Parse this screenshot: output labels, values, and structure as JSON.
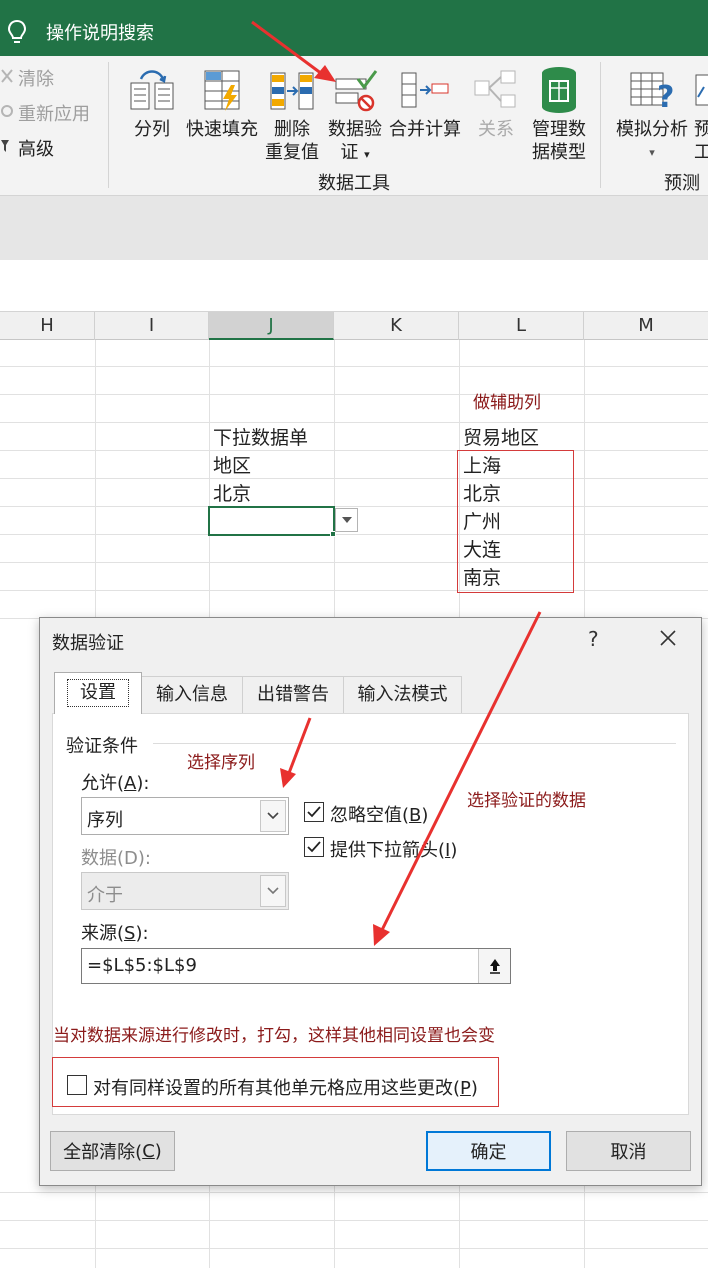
{
  "titlebar": {
    "search_text": "操作说明搜索",
    "bg_color": "#217346"
  },
  "ribbon": {
    "sort_filter": {
      "clear_label": "清除",
      "reapply_label": "重新应用",
      "advanced_label": "高级"
    },
    "data_tools": {
      "group_label": "数据工具",
      "text_to_columns": "分列",
      "flash_fill": "快速填充",
      "remove_duplicates_1": "删除",
      "remove_duplicates_2": "重复值",
      "data_validation_1": "数据验",
      "data_validation_2": "证",
      "consolidate": "合并计算",
      "relationships": "关系",
      "manage_data_model_1": "管理数",
      "manage_data_model_2": "据模型"
    },
    "forecast": {
      "group_label": "预测",
      "what_if_analysis": "模拟分析",
      "forecast_sheet_partial_1": "预",
      "forecast_sheet_partial_2": "工"
    }
  },
  "sheet": {
    "columns": [
      "H",
      "I",
      "J",
      "K",
      "L",
      "M"
    ],
    "selected_column": "J",
    "cells": {
      "j_header": "下拉数据单",
      "j_region": "地区",
      "j_beijing": "北京",
      "l_header": "贸易地区",
      "l_items": [
        "上海",
        "北京",
        "广州",
        "大连",
        "南京"
      ]
    }
  },
  "annotations": {
    "helper_column": "做辅助列",
    "select_sequence": "选择序列",
    "select_validation_data": "选择验证的数据",
    "apply_note": "当对数据来源进行修改时，打勾，这样其他相同设置也会变",
    "annotation_color": "#8b1a1a",
    "arrow_color": "#e8312f"
  },
  "dialog": {
    "title": "数据验证",
    "help": "?",
    "tabs": [
      "设置",
      "输入信息",
      "出错警告",
      "输入法模式"
    ],
    "active_tab": "设置",
    "section_title": "验证条件",
    "allow": {
      "label_prefix": "允许(",
      "label_key": "A",
      "label_suffix": "):",
      "value": "序列"
    },
    "data": {
      "label": "数据(D):",
      "value": "介于"
    },
    "ignore_blank": {
      "label_prefix": "忽略空值(",
      "label_key": "B",
      "label_suffix": ")",
      "checked": true
    },
    "in_cell_dropdown": {
      "label_prefix": "提供下拉箭头(",
      "label_key": "I",
      "label_suffix": ")",
      "checked": true
    },
    "source": {
      "label_prefix": "来源(",
      "label_key": "S",
      "label_suffix": "):",
      "value": "=$L$5:$L$9"
    },
    "apply_all": {
      "label_prefix": "对有同样设置的所有其他单元格应用这些更改(",
      "label_key": "P",
      "label_suffix": ")",
      "checked": false
    },
    "buttons": {
      "clear_all_prefix": "全部清除(",
      "clear_all_key": "C",
      "clear_all_suffix": ")",
      "ok": "确定",
      "cancel": "取消"
    }
  }
}
